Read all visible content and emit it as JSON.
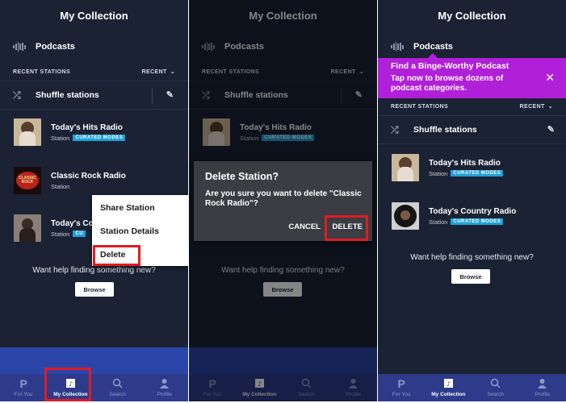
{
  "header": {
    "title": "My Collection"
  },
  "podcasts_label": "Podcasts",
  "recent_stations": {
    "label": "RECENT STATIONS",
    "sort": "RECENT"
  },
  "shuffle_label": "Shuffle stations",
  "stations": [
    {
      "title": "Today's Hits Radio",
      "sub": "Station",
      "badge": "CURATED MODES"
    },
    {
      "title": "Classic Rock Radio",
      "sub": "Station",
      "badge": ""
    },
    {
      "title": "Today's Country Radio",
      "sub": "Station",
      "badge": "CURATED MODES"
    }
  ],
  "clipped_title": "Today's Co",
  "clipped_badge": "CU",
  "classic_rock_art": "CLASSIC ROCK",
  "help_text": "Want help finding something new?",
  "browse_label": "Browse",
  "context_menu": [
    "Share Station",
    "Station Details",
    "Delete"
  ],
  "dialog": {
    "title": "Delete Station?",
    "body": "Are you sure you want to delete \"Classic Rock Radio\"?",
    "cancel": "CANCEL",
    "delete": "DELETE"
  },
  "promo": {
    "title": "Find a Binge-Worthy Podcast",
    "subtitle": "Tap now to browse dozens of podcast categories."
  },
  "nav": [
    {
      "label": "For You",
      "icon": "pandora-p-icon"
    },
    {
      "label": "My Collection",
      "icon": "collection-icon",
      "active": true
    },
    {
      "label": "Search",
      "icon": "search-icon"
    },
    {
      "label": "Profile",
      "icon": "profile-icon"
    }
  ],
  "colors": {
    "background": "#1a2234",
    "badge": "#1fa0d8",
    "promo": "#b020d8",
    "nav": "#2d3b8a",
    "highlight": "#e01b24"
  }
}
